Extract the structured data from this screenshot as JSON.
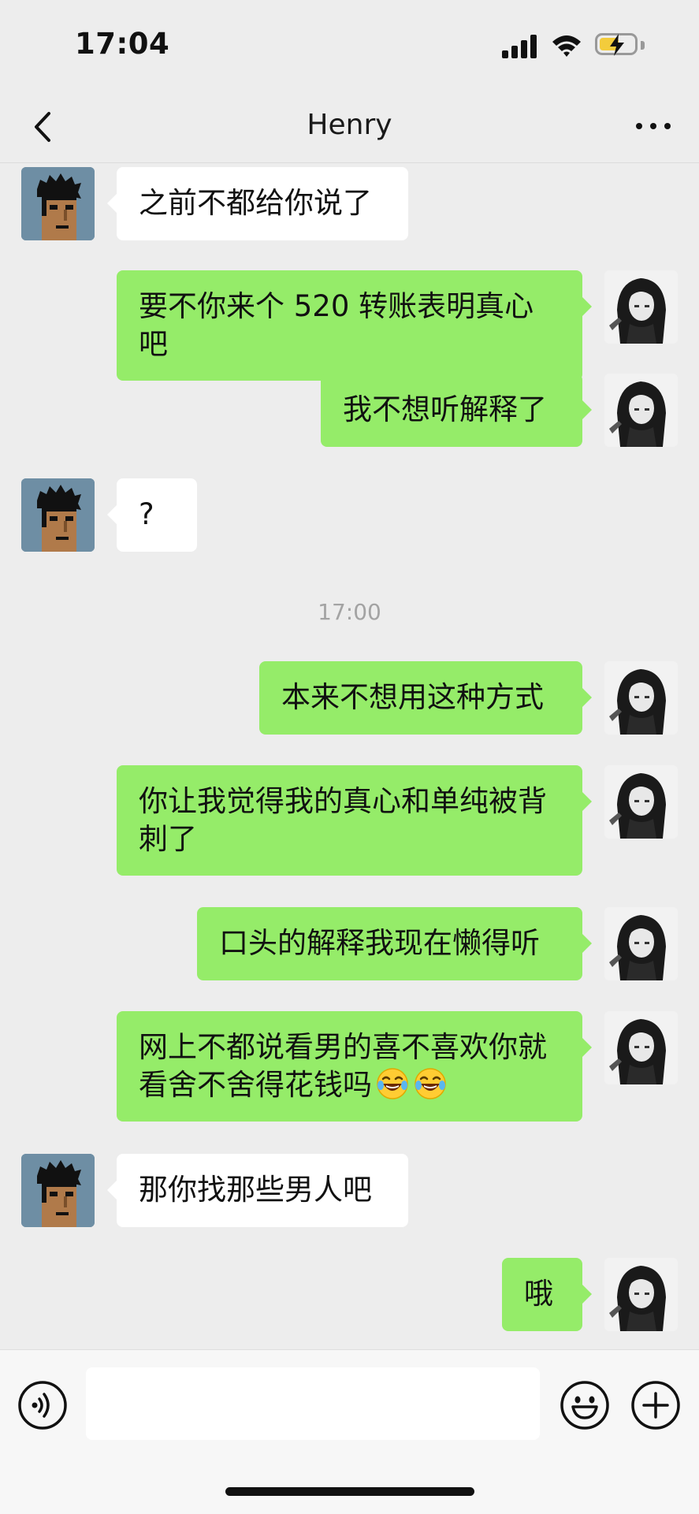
{
  "status_bar": {
    "time": "17:04",
    "battery_color": "#f3cc3c"
  },
  "nav": {
    "title": "Henry",
    "back_icon": "chevron-left-icon",
    "more_icon": "more-dots-icon"
  },
  "colors": {
    "sent_bubble": "#95ec69",
    "received_bubble": "#ffffff",
    "background": "#ededed"
  },
  "messages": [
    {
      "side": "left",
      "text": "之前不都给你说了"
    },
    {
      "side": "right",
      "text": "要不你来个 520 转账表明真心吧"
    },
    {
      "side": "right",
      "text": "我不想听解释了"
    },
    {
      "side": "left",
      "text": "?"
    },
    {
      "type": "time",
      "text": "17:00"
    },
    {
      "side": "right",
      "text": "本来不想用这种方式"
    },
    {
      "side": "right",
      "line1": "你让我觉得我的真心和单纯被背",
      "line2": "刺了"
    },
    {
      "side": "right",
      "text": "口头的解释我现在懒得听"
    },
    {
      "side": "right",
      "line1": "网上不都说看男的喜不喜欢你就",
      "line2": "看舍不舍得花钱吗",
      "emoji": "laughing-tears-icon"
    },
    {
      "side": "left",
      "text": "那你找那些男人吧"
    },
    {
      "side": "right",
      "text": "哦"
    }
  ],
  "input_bar": {
    "placeholder": "",
    "icons": [
      "voice-icon",
      "emoji-icon",
      "plus-icon"
    ]
  }
}
